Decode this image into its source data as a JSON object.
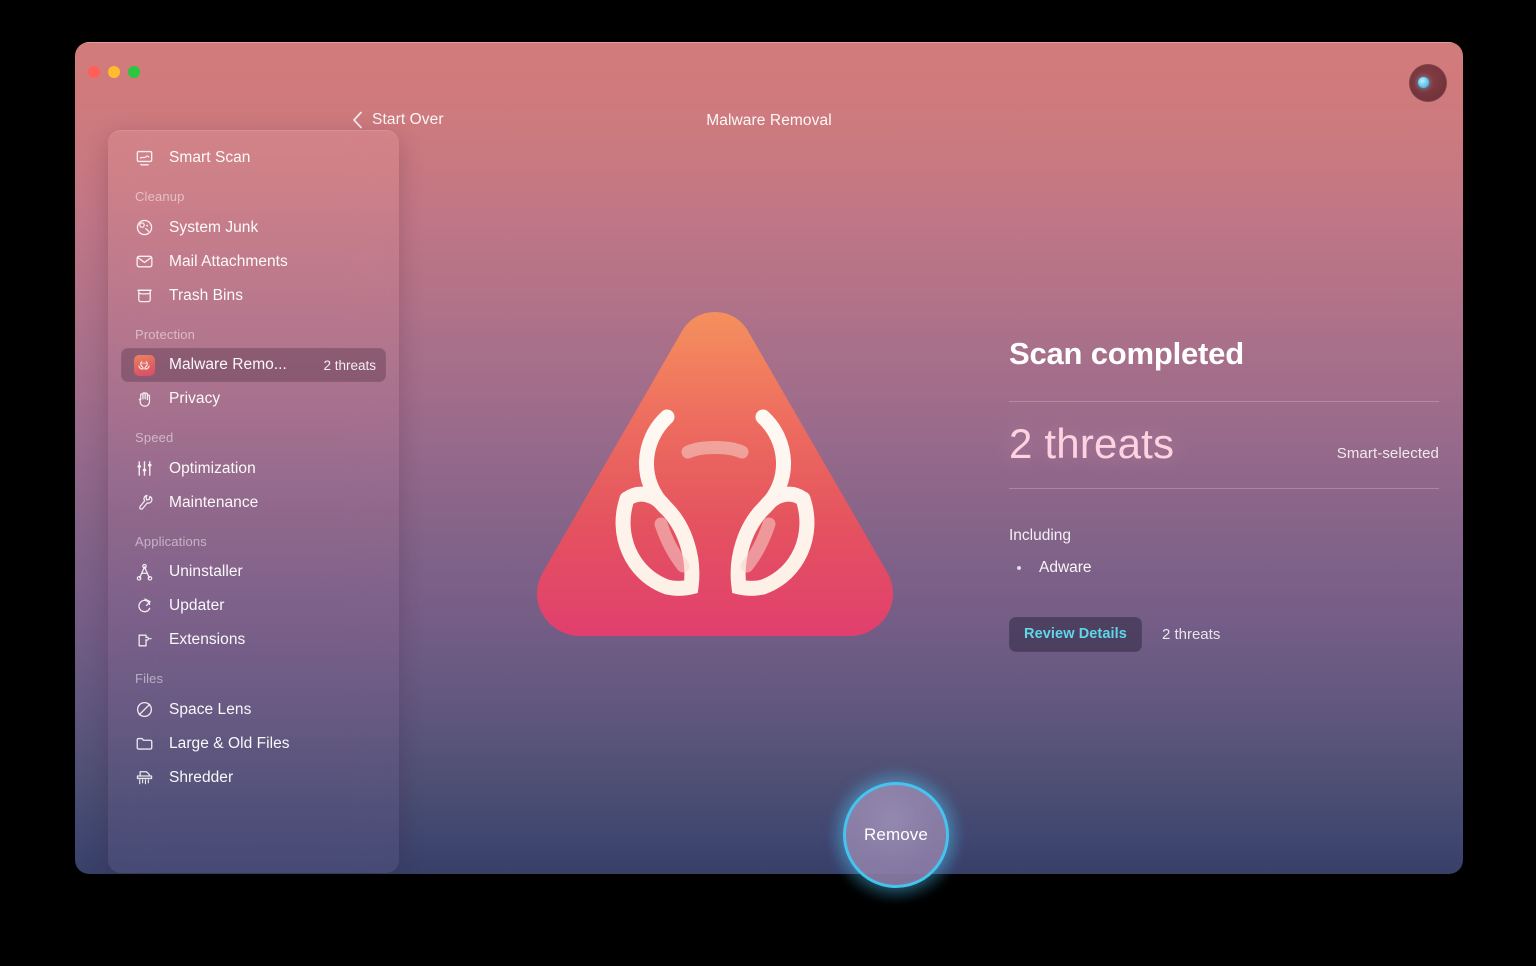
{
  "window": {
    "title": "Malware Removal",
    "back_label": "Start Over",
    "traffic_lights": [
      "close",
      "minimize",
      "maximize"
    ],
    "account_icon": "account-avatar-icon"
  },
  "colors": {
    "accent_cyan": "#45c4ef",
    "link_cyan": "#5fd7e8",
    "threat_pink": "#ffd2e2",
    "bg_top": "#d37b7b",
    "bg_bottom": "#384068",
    "hazard_top": "#f08a5f",
    "hazard_bottom": "#e0456d"
  },
  "sidebar": {
    "top_items": [
      {
        "label": "Smart Scan",
        "icon": "smart-scan-icon",
        "selected": false,
        "badge": ""
      }
    ],
    "groups": [
      {
        "label": "Cleanup",
        "items": [
          {
            "label": "System Junk",
            "icon": "system-junk-icon",
            "selected": false,
            "badge": ""
          },
          {
            "label": "Mail Attachments",
            "icon": "mail-attachments-icon",
            "selected": false,
            "badge": ""
          },
          {
            "label": "Trash Bins",
            "icon": "trash-bins-icon",
            "selected": false,
            "badge": ""
          }
        ]
      },
      {
        "label": "Protection",
        "items": [
          {
            "label": "Malware Remo...",
            "icon": "biohazard-icon",
            "selected": true,
            "badge": "2 threats"
          },
          {
            "label": "Privacy",
            "icon": "privacy-hand-icon",
            "selected": false,
            "badge": ""
          }
        ]
      },
      {
        "label": "Speed",
        "items": [
          {
            "label": "Optimization",
            "icon": "optimization-sliders-icon",
            "selected": false,
            "badge": ""
          },
          {
            "label": "Maintenance",
            "icon": "maintenance-wrench-icon",
            "selected": false,
            "badge": ""
          }
        ]
      },
      {
        "label": "Applications",
        "items": [
          {
            "label": "Uninstaller",
            "icon": "uninstaller-icon",
            "selected": false,
            "badge": ""
          },
          {
            "label": "Updater",
            "icon": "updater-refresh-icon",
            "selected": false,
            "badge": ""
          },
          {
            "label": "Extensions",
            "icon": "extensions-puzzle-icon",
            "selected": false,
            "badge": ""
          }
        ]
      },
      {
        "label": "Files",
        "items": [
          {
            "label": "Space Lens",
            "icon": "space-lens-icon",
            "selected": false,
            "badge": ""
          },
          {
            "label": "Large & Old Files",
            "icon": "folder-icon",
            "selected": false,
            "badge": ""
          },
          {
            "label": "Shredder",
            "icon": "shredder-icon",
            "selected": false,
            "badge": ""
          }
        ]
      }
    ]
  },
  "main": {
    "hero_icon": "biohazard-warning-triangle-icon",
    "status_title": "Scan completed",
    "threat_count_text": "2 threats",
    "selection_mode": "Smart-selected",
    "including_label": "Including",
    "including_items": [
      "Adware"
    ],
    "review_details_label": "Review Details",
    "details_count_text": "2 threats",
    "bullet_glyph": "•"
  },
  "action": {
    "remove_label": "Remove"
  }
}
